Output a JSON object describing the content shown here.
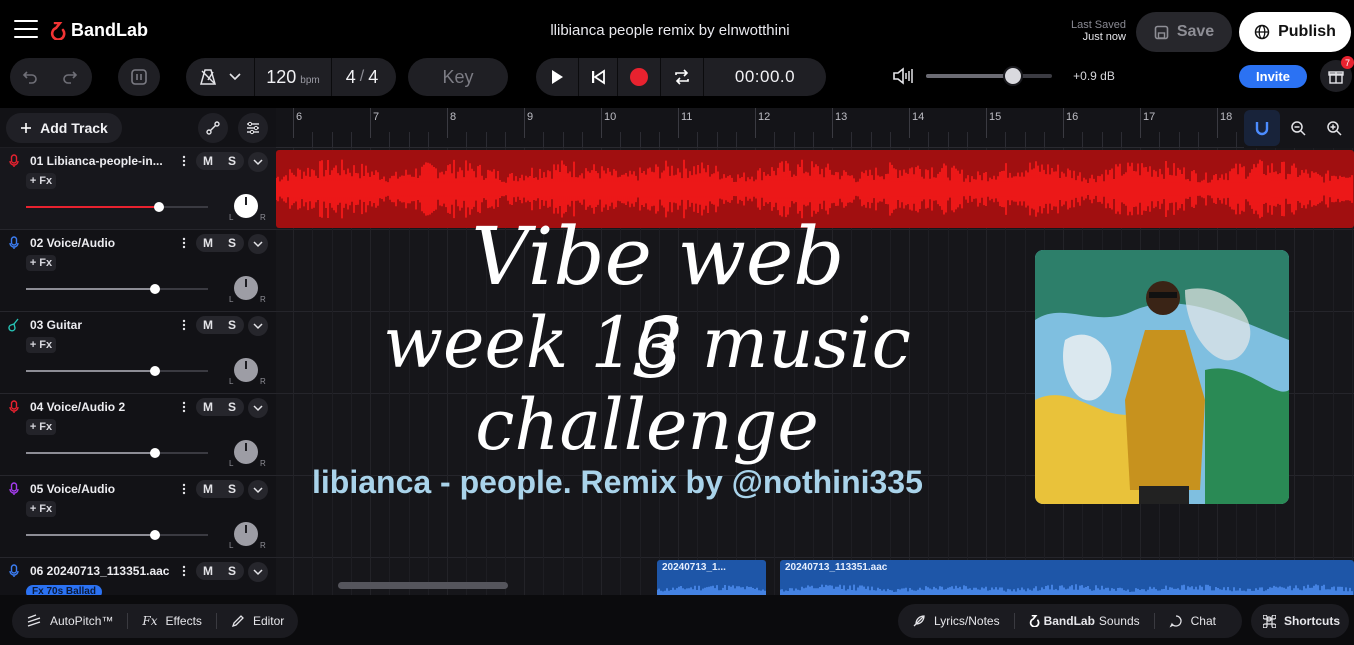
{
  "header": {
    "brand": "BandLab",
    "project_title": "llibianca people remix by elnwotthini",
    "last_saved_label": "Last Saved",
    "last_saved_value": "Just now",
    "save_label": "Save",
    "publish_label": "Publish"
  },
  "transport": {
    "bpm": "120",
    "bpm_unit": "bpm",
    "sig_top": "4",
    "sig_sep": "/",
    "sig_bottom": "4",
    "key_label": "Key",
    "time": "00:00.0",
    "master_volume_fraction": 0.69,
    "gain": "+0.9 dB",
    "invite_label": "Invite",
    "gift_badge": "7"
  },
  "panel": {
    "add_track_label": "Add Track"
  },
  "ruler": {
    "bars": [
      "6",
      "7",
      "8",
      "9",
      "10",
      "11",
      "12",
      "13",
      "14",
      "15",
      "16",
      "17",
      "18"
    ]
  },
  "tracks": [
    {
      "name": "01  Libianca-people-in...",
      "mute": "M",
      "solo": "S",
      "fx": "+ Fx",
      "icon": "mic-icon",
      "color": "#e8222f",
      "volume_fraction": 0.73,
      "pan_left": "L",
      "pan_right": "R",
      "selected": true
    },
    {
      "name": "02  Voice/Audio",
      "mute": "M",
      "solo": "S",
      "fx": "+ Fx",
      "icon": "mic-icon",
      "color": "#3c7ef4",
      "volume_fraction": 0.71,
      "pan_left": "L",
      "pan_right": "R"
    },
    {
      "name": "03  Guitar",
      "mute": "M",
      "solo": "S",
      "fx": "+ Fx",
      "icon": "guitar-icon",
      "color": "#27c3b5",
      "volume_fraction": 0.71,
      "pan_left": "L",
      "pan_right": "R"
    },
    {
      "name": "04  Voice/Audio 2",
      "mute": "M",
      "solo": "S",
      "fx": "+ Fx",
      "icon": "mic-icon",
      "color": "#e8222f",
      "volume_fraction": 0.71,
      "pan_left": "L",
      "pan_right": "R"
    },
    {
      "name": "05  Voice/Audio",
      "mute": "M",
      "solo": "S",
      "fx": "+ Fx",
      "icon": "mic-icon",
      "color": "#a63cf0",
      "volume_fraction": 0.71,
      "pan_left": "L",
      "pan_right": "R"
    },
    {
      "name": "06  20240713_113351.aac",
      "mute": "M",
      "solo": "S",
      "fx_tag": "Fx 70s Ballad",
      "icon": "mic-icon",
      "color": "#3c7ef4"
    }
  ],
  "regions": {
    "blue_1": "20240713_1...",
    "blue_2": "20240713_113351.aac"
  },
  "overlay": {
    "line1": "Vibe web 3",
    "line2": "week 16 music challenge",
    "subtitle": "libianca - people. Remix by @nothini335"
  },
  "footer": {
    "autopitch": "AutoPitch™",
    "effects": "Effects",
    "editor": "Editor",
    "lyrics": "Lyrics/Notes",
    "sounds": "Sounds",
    "sounds_brand": "BandLab",
    "chat": "Chat",
    "shortcuts": "Shortcuts"
  },
  "colors": {
    "accent": "#2b72f3",
    "record": "#e8222f",
    "waveform_red": "#ff1a1a"
  }
}
